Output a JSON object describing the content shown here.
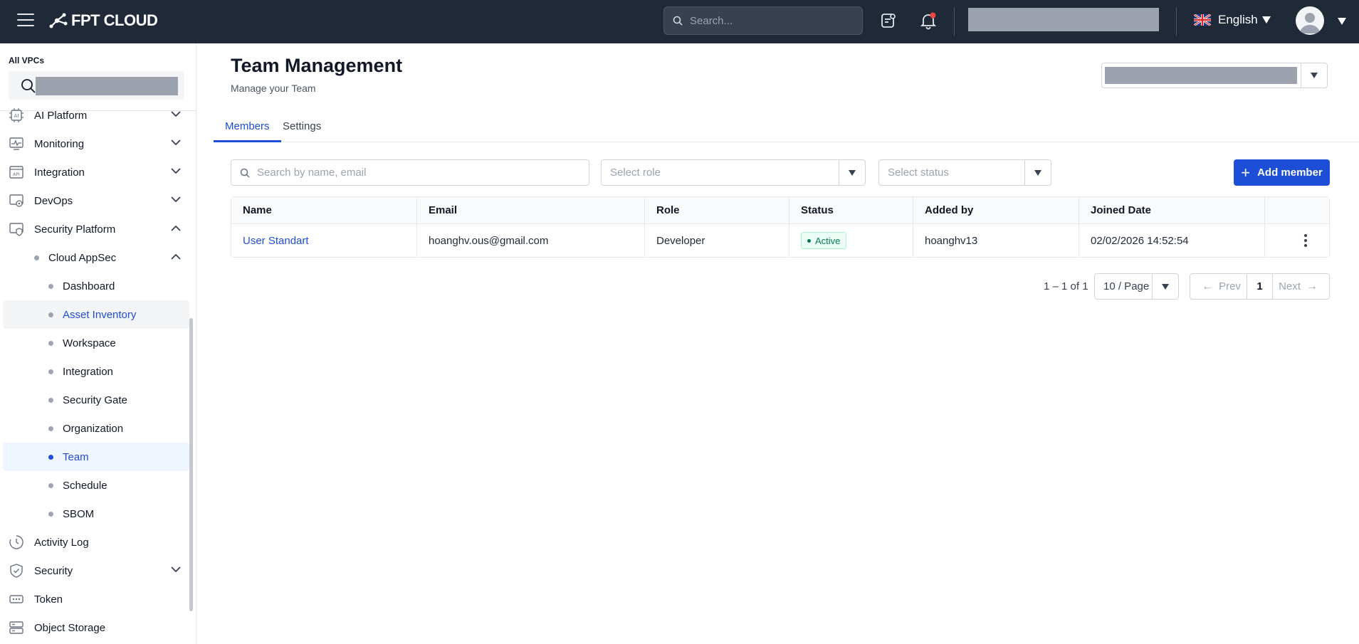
{
  "header": {
    "brand": "FPT CLOUD",
    "search_placeholder": "Search...",
    "language": "English"
  },
  "sidebar": {
    "vpc_label": "All VPCs",
    "items": [
      {
        "label": "AI Platform",
        "icon": "ai-chip-icon"
      },
      {
        "label": "Monitoring",
        "icon": "monitor-icon"
      },
      {
        "label": "Integration",
        "icon": "api-icon"
      },
      {
        "label": "DevOps",
        "icon": "devops-icon"
      },
      {
        "label": "Security Platform",
        "icon": "security-platform-icon"
      },
      {
        "label": "Cloud AppSec"
      },
      {
        "label": "Dashboard"
      },
      {
        "label": "Asset Inventory"
      },
      {
        "label": "Workspace"
      },
      {
        "label": "Integration"
      },
      {
        "label": "Security Gate"
      },
      {
        "label": "Organization"
      },
      {
        "label": "Team"
      },
      {
        "label": "Schedule"
      },
      {
        "label": "SBOM"
      },
      {
        "label": "Activity Log",
        "icon": "clock-icon"
      },
      {
        "label": "Security",
        "icon": "shield-icon"
      },
      {
        "label": "Token",
        "icon": "token-icon"
      },
      {
        "label": "Object Storage",
        "icon": "storage-icon"
      }
    ]
  },
  "page": {
    "title": "Team Management",
    "subtitle": "Manage your Team",
    "tabs": [
      "Members",
      "Settings"
    ]
  },
  "filters": {
    "search_placeholder": "Search by name, email",
    "role_placeholder": "Select role",
    "status_placeholder": "Select status",
    "add_button": "Add member"
  },
  "table": {
    "columns": [
      "Name",
      "Email",
      "Role",
      "Status",
      "Added by",
      "Joined Date"
    ],
    "rows": [
      {
        "name": "User Standart",
        "email": "hoanghv.ous@gmail.com",
        "role": "Developer",
        "status": "Active",
        "added_by": "hoanghv13",
        "joined": "02/02/2026 14:52:54"
      }
    ]
  },
  "pagination": {
    "range": "1 – 1 of 1",
    "page_size": "10 / Page",
    "prev": "Prev",
    "current": "1",
    "next": "Next"
  },
  "colors": {
    "topbar": "#1f2937",
    "accent": "#1d4ed8",
    "active_badge": "#047857",
    "notification": "#ef4444"
  }
}
